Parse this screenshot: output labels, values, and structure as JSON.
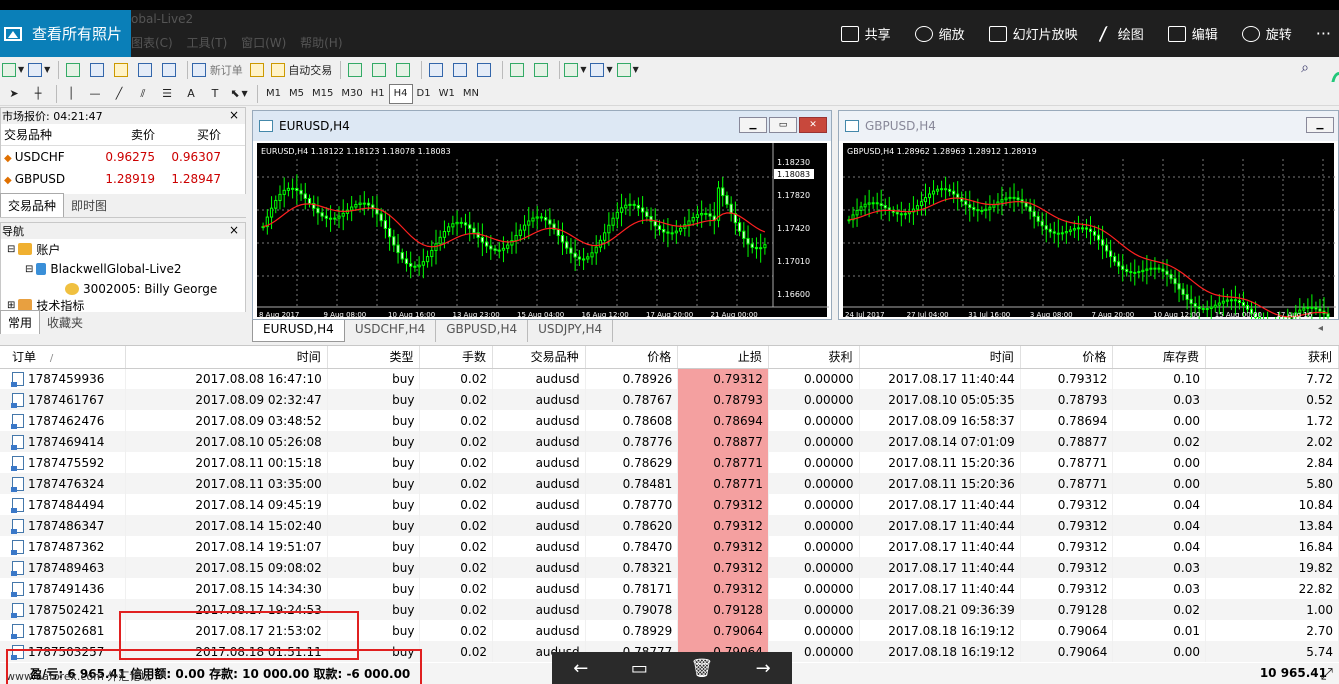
{
  "viewer": {
    "view_all_label": "查看所有照片",
    "ghost_title": "obal-Live2",
    "ghost_menu": "图表(C) 工具(T) 窗口(W) 帮助(H)",
    "actions": [
      {
        "label": "共享",
        "icon": "share-icon"
      },
      {
        "label": "缩放",
        "icon": "zoom-icon"
      },
      {
        "label": "幻灯片放映",
        "icon": "slideshow-icon"
      },
      {
        "label": "绘图",
        "icon": "draw-icon"
      },
      {
        "label": "编辑",
        "icon": "edit-icon"
      },
      {
        "label": "旋转",
        "icon": "rotate-icon"
      }
    ],
    "more_label": "···"
  },
  "toolbar": {
    "new_order_label": "新订单",
    "auto_trade_label": "自动交易",
    "text_tool_label": "A",
    "timeframes": [
      "M1",
      "M5",
      "M15",
      "M30",
      "H1",
      "H4",
      "D1",
      "W1",
      "MN"
    ],
    "active_timeframe": "H4"
  },
  "market": {
    "title": "市场报价: 04:21:47",
    "headers": [
      "交易品种",
      "卖价",
      "买价"
    ],
    "rows": [
      {
        "symbol": "USDCHF",
        "bid": "0.96275",
        "ask": "0.96307"
      },
      {
        "symbol": "GBPUSD",
        "bid": "1.28919",
        "ask": "1.28947"
      }
    ],
    "tabs": [
      "交易品种",
      "即时图"
    ]
  },
  "navigator": {
    "title": "导航",
    "items": [
      {
        "label": "账户"
      },
      {
        "label": "BlackwellGlobal-Live2"
      },
      {
        "label": "3002005: Billy  George"
      },
      {
        "label": "技术指标"
      }
    ],
    "tabs": [
      "常用",
      "收藏夹"
    ]
  },
  "charts": [
    {
      "title": "EURUSD,H4",
      "info": "EURUSD,H4  1.18122 1.18123 1.18078 1.18083",
      "price_labels": [
        "1.18230",
        "1.18083",
        "1.17820",
        "1.17420",
        "1.17010",
        "1.16600"
      ],
      "time_labels": [
        "8 Aug 2017",
        "9 Aug 08:00",
        "10 Aug 16:00",
        "13 Aug 23:00",
        "15 Aug 04:00",
        "16 Aug 12:00",
        "17 Aug 20:00",
        "21 Aug 00:00"
      ]
    },
    {
      "title": "GBPUSD,H4",
      "info": "GBPUSD,H4  1.28962 1.28963 1.28912 1.28919",
      "time_labels": [
        "24 Jul 2017",
        "27 Jul 04:00",
        "31 Jul 16:00",
        "3 Aug 08:00",
        "7 Aug 20:00",
        "10 Aug 12:00",
        "15 Aug 00:00",
        "17 Aug 16"
      ]
    }
  ],
  "chart_tabs": [
    "EURUSD,H4",
    "USDCHF,H4",
    "GBPUSD,H4",
    "USDJPY,H4"
  ],
  "orders": {
    "headers": [
      "订单",
      "时间",
      "类型",
      "手数",
      "交易品种",
      "价格",
      "止损",
      "获利",
      "时间",
      "价格",
      "库存费",
      "获利"
    ],
    "sort_indicator": "/",
    "rows": [
      [
        "1787459936",
        "2017.08.08 16:47:10",
        "buy",
        "0.02",
        "audusd",
        "0.78926",
        "0.79312",
        "0.00000",
        "2017.08.17 11:40:44",
        "0.79312",
        "0.10",
        "7.72"
      ],
      [
        "1787461767",
        "2017.08.09 02:32:47",
        "buy",
        "0.02",
        "audusd",
        "0.78767",
        "0.78793",
        "0.00000",
        "2017.08.10 05:05:35",
        "0.78793",
        "0.03",
        "0.52"
      ],
      [
        "1787462476",
        "2017.08.09 03:48:52",
        "buy",
        "0.02",
        "audusd",
        "0.78608",
        "0.78694",
        "0.00000",
        "2017.08.09 16:58:37",
        "0.78694",
        "0.00",
        "1.72"
      ],
      [
        "1787469414",
        "2017.08.10 05:26:08",
        "buy",
        "0.02",
        "audusd",
        "0.78776",
        "0.78877",
        "0.00000",
        "2017.08.14 07:01:09",
        "0.78877",
        "0.02",
        "2.02"
      ],
      [
        "1787475592",
        "2017.08.11 00:15:18",
        "buy",
        "0.02",
        "audusd",
        "0.78629",
        "0.78771",
        "0.00000",
        "2017.08.11 15:20:36",
        "0.78771",
        "0.00",
        "2.84"
      ],
      [
        "1787476324",
        "2017.08.11 03:35:00",
        "buy",
        "0.02",
        "audusd",
        "0.78481",
        "0.78771",
        "0.00000",
        "2017.08.11 15:20:36",
        "0.78771",
        "0.00",
        "5.80"
      ],
      [
        "1787484494",
        "2017.08.14 09:45:19",
        "buy",
        "0.02",
        "audusd",
        "0.78770",
        "0.79312",
        "0.00000",
        "2017.08.17 11:40:44",
        "0.79312",
        "0.04",
        "10.84"
      ],
      [
        "1787486347",
        "2017.08.14 15:02:40",
        "buy",
        "0.02",
        "audusd",
        "0.78620",
        "0.79312",
        "0.00000",
        "2017.08.17 11:40:44",
        "0.79312",
        "0.04",
        "13.84"
      ],
      [
        "1787487362",
        "2017.08.14 19:51:07",
        "buy",
        "0.02",
        "audusd",
        "0.78470",
        "0.79312",
        "0.00000",
        "2017.08.17 11:40:44",
        "0.79312",
        "0.04",
        "16.84"
      ],
      [
        "1787489463",
        "2017.08.15 09:08:02",
        "buy",
        "0.02",
        "audusd",
        "0.78321",
        "0.79312",
        "0.00000",
        "2017.08.17 11:40:44",
        "0.79312",
        "0.03",
        "19.82"
      ],
      [
        "1787491436",
        "2017.08.15 14:34:30",
        "buy",
        "0.02",
        "audusd",
        "0.78171",
        "0.79312",
        "0.00000",
        "2017.08.17 11:40:44",
        "0.79312",
        "0.03",
        "22.82"
      ],
      [
        "1787502421",
        "2017.08.17 19:24:53",
        "buy",
        "0.02",
        "audusd",
        "0.79078",
        "0.79128",
        "0.00000",
        "2017.08.21 09:36:39",
        "0.79128",
        "0.02",
        "1.00"
      ],
      [
        "1787502681",
        "2017.08.17 21:53:02",
        "buy",
        "0.02",
        "audusd",
        "0.78929",
        "0.79064",
        "0.00000",
        "2017.08.18 16:19:12",
        "0.79064",
        "0.01",
        "2.70"
      ],
      [
        "1787503257",
        "2017.08.18 01:51:11",
        "buy",
        "0.02",
        "audusd",
        "0.78777",
        "0.79064",
        "0.00000",
        "2017.08.18 16:19:12",
        "0.79064",
        "0.00",
        "5.74"
      ]
    ]
  },
  "status": {
    "summary": "盈/亏: 6 965.41  信用额: 0.00  存款: 10 000.00  取款: -6 000.00",
    "total": "10 965.41",
    "watermark": "www.aaforex.com 外汇论坛"
  },
  "colors": {
    "stoploss_highlight": "#f4a0a0",
    "candle": "#00ff00",
    "moving_average": "#ff2020",
    "accent": "#0a7fb8",
    "annotation_box": "#e02020"
  }
}
